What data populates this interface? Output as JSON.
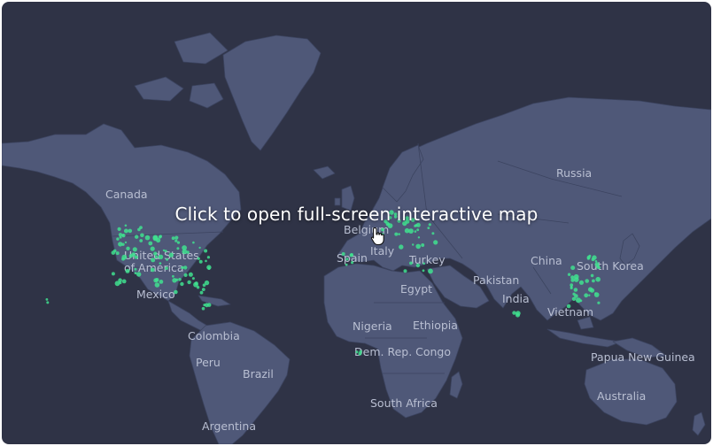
{
  "map": {
    "cta_label": "Click to open full-screen interactive map",
    "accent_color": "#3fe08f",
    "background_color": "#2f3346",
    "land_color": "#4f5878",
    "cursor_icon": "hand-pointer-icon",
    "country_labels": [
      {
        "id": "canada",
        "text": "Canada"
      },
      {
        "id": "usa-1",
        "text": "United States"
      },
      {
        "id": "usa-2",
        "text": "of America"
      },
      {
        "id": "mexico",
        "text": "Mexico"
      },
      {
        "id": "colombia",
        "text": "Colombia"
      },
      {
        "id": "peru",
        "text": "Peru"
      },
      {
        "id": "brazil",
        "text": "Brazil"
      },
      {
        "id": "argentina",
        "text": "Argentina"
      },
      {
        "id": "russia",
        "text": "Russia"
      },
      {
        "id": "belgium",
        "text": "Belgium"
      },
      {
        "id": "spain",
        "text": "Spain"
      },
      {
        "id": "italy",
        "text": "Italy"
      },
      {
        "id": "turkey",
        "text": "Turkey"
      },
      {
        "id": "egypt",
        "text": "Egypt"
      },
      {
        "id": "pakistan",
        "text": "Pakistan"
      },
      {
        "id": "india",
        "text": "India"
      },
      {
        "id": "china",
        "text": "China"
      },
      {
        "id": "south-korea",
        "text": "South Korea"
      },
      {
        "id": "vietnam",
        "text": "Vietnam"
      },
      {
        "id": "nigeria",
        "text": "Nigeria"
      },
      {
        "id": "ethiopia",
        "text": "Ethiopia"
      },
      {
        "id": "dr-congo",
        "text": "Dem. Rep. Congo"
      },
      {
        "id": "papua-new-guinea",
        "text": "Papua New Guinea"
      },
      {
        "id": "australia",
        "text": "Australia"
      },
      {
        "id": "south-africa",
        "text": "South Africa"
      }
    ]
  }
}
